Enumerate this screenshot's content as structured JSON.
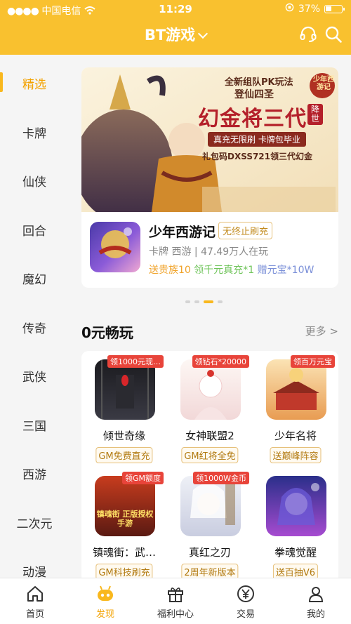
{
  "status": {
    "carrier": "中国电信",
    "time": "11:29",
    "battery": "37%"
  },
  "header": {
    "title": "BT游戏"
  },
  "sidebar": {
    "items": [
      {
        "label": "精选"
      },
      {
        "label": "卡牌"
      },
      {
        "label": "仙侠"
      },
      {
        "label": "回合"
      },
      {
        "label": "魔幻"
      },
      {
        "label": "传奇"
      },
      {
        "label": "武侠"
      },
      {
        "label": "三国"
      },
      {
        "label": "西游"
      },
      {
        "label": "二次元"
      },
      {
        "label": "动漫"
      }
    ]
  },
  "banner": {
    "promo_line1": "全新组队PK玩法",
    "promo_line2": "登仙四圣",
    "promo_title": "幻金将三代",
    "promo_seal": "降世",
    "promo_sub": "真充无限刷 卡牌包毕业",
    "promo_code": "礼包码DXSS721领三代幻金",
    "logo_text": "少年西游记",
    "game": {
      "name": "少年西游记",
      "badge": "无终止刷充",
      "meta": "卡牌 西游 | 47.49万人在玩",
      "perk1": "送贵族10",
      "perk2": "领千元真充*1",
      "perk3": "赠元宝*10W"
    }
  },
  "section": {
    "title": "0元畅玩",
    "more": "更多 >"
  },
  "games": [
    {
      "name": "倾世奇缘",
      "tag": "领1000元现…",
      "badge": "GM免费直充"
    },
    {
      "name": "女神联盟2",
      "tag": "领钻石*20000",
      "badge": "GM红将全免"
    },
    {
      "name": "少年名将",
      "tag": "领百万元宝",
      "badge": "送巅峰阵容"
    },
    {
      "name": "镇魂街：武…",
      "tag": "领GM额度",
      "badge": "GM科技刷充",
      "art": "镇魂街 正版授权手游"
    },
    {
      "name": "真红之刃",
      "tag": "领1000W金币",
      "badge": "2周年新版本"
    },
    {
      "name": "拳魂觉醒",
      "tag": "",
      "badge": "送百抽V6"
    }
  ],
  "tabs": [
    {
      "label": "首页"
    },
    {
      "label": "发现"
    },
    {
      "label": "福利中心"
    },
    {
      "label": "交易"
    },
    {
      "label": "我的"
    }
  ],
  "colors": {
    "brand": "#f9c12f",
    "accent": "#f3a200",
    "tag_red": "#e8443a"
  }
}
